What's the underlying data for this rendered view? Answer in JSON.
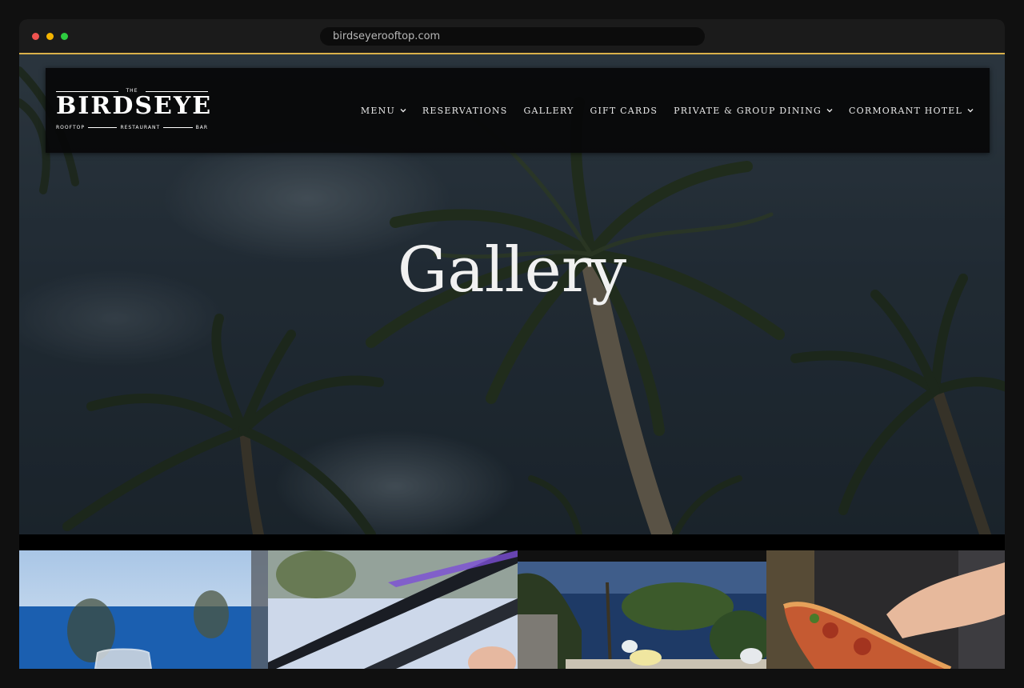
{
  "browser": {
    "url": "birdseyerooftop.com"
  },
  "logo": {
    "top_text": "THE",
    "wordmark": "BIRDSEYE",
    "sub_left": "ROOFTOP",
    "sub_mid": "RESTAURANT",
    "sub_right": "BAR"
  },
  "nav": {
    "items": [
      {
        "label": "MENU",
        "dropdown": true
      },
      {
        "label": "RESERVATIONS",
        "dropdown": false
      },
      {
        "label": "GALLERY",
        "dropdown": false
      },
      {
        "label": "GIFT CARDS",
        "dropdown": false
      },
      {
        "label": "PRIVATE & GROUP DINING",
        "dropdown": true
      },
      {
        "label": "CORMORANT HOTEL",
        "dropdown": true
      }
    ]
  },
  "hero": {
    "title": "Gallery"
  },
  "colors": {
    "accent": "#d9b04a",
    "header_bg": "#060608",
    "text": "#e9e9e9"
  },
  "gallery": {
    "thumbs": [
      {
        "name": "wine-glass-ocean-view"
      },
      {
        "name": "rooftop-glass-railing"
      },
      {
        "name": "ocean-palm-table-view"
      },
      {
        "name": "pizza-slice-hand"
      }
    ]
  }
}
